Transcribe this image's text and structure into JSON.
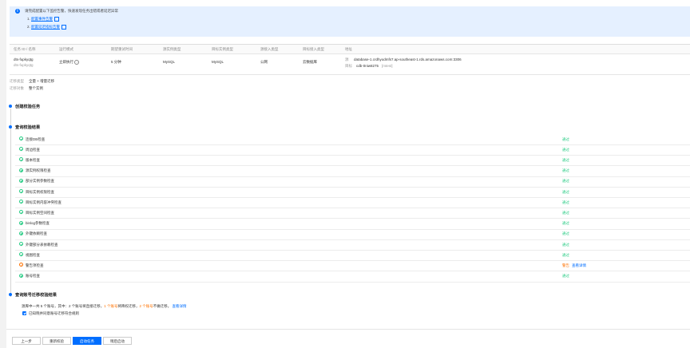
{
  "alert": {
    "message": "请完成配置以下监控告警，快速发现任务出错或者延迟异常",
    "items": [
      {
        "num": "1.",
        "label": "配置事件告警"
      },
      {
        "num": "2.",
        "label": "配置延迟指标告警"
      }
    ]
  },
  "task_table": {
    "columns": [
      "任务 ID / 名称",
      "运行模式",
      "期望重试时间",
      "源实例类型",
      "目标实例类型",
      "源接入类型",
      "目标接入类型",
      "地址"
    ],
    "row": {
      "task_id": "dts-fupkyqtg",
      "task_name": "dts-fupkyqtg",
      "mode": "立即执行",
      "retry": "5 分钟",
      "src_type": "MySQL",
      "dst_type": "MySQL",
      "src_access": "公网",
      "dst_access": "云数据库",
      "src_addr_label": "源",
      "src_addr": "database-1.crdhyodmfs7.ap-southeast-1.rds.amazonaws.com:3306",
      "dst_addr_label": "目标",
      "dst_addr": "cdb-0niw8275",
      "dst_tag": "[mtest]"
    }
  },
  "migration": {
    "type_label": "迁移类型",
    "type_value": "全量 + 增量迁移",
    "object_label": "迁移对象",
    "object_value": "整个实例"
  },
  "sections": {
    "create": "创建校验任务",
    "results": "查询校验结果",
    "account": "查询账号迁移校验结果"
  },
  "checks": [
    {
      "name": "连接DB检查",
      "status": "通过",
      "state": "ok"
    },
    {
      "name": "周边检查",
      "status": "通过",
      "state": "ok"
    },
    {
      "name": "版本检查",
      "status": "通过",
      "state": "ok"
    },
    {
      "name": "源实例权限检查",
      "status": "通过",
      "state": "ok"
    },
    {
      "name": "部分实例参数检查",
      "status": "通过",
      "state": "ok"
    },
    {
      "name": "目标实例权限检查",
      "status": "通过",
      "state": "ok"
    },
    {
      "name": "目标实例内容冲突检查",
      "status": "通过",
      "state": "ok"
    },
    {
      "name": "目标实例空间检查",
      "status": "通过",
      "state": "ok"
    },
    {
      "name": "binlog参数检查",
      "status": "通过",
      "state": "ok"
    },
    {
      "name": "外键依赖检查",
      "status": "通过",
      "state": "ok"
    },
    {
      "name": "外键部分表依赖检查",
      "status": "通过",
      "state": "ok"
    },
    {
      "name": "视图检查",
      "status": "通过",
      "state": "ok"
    },
    {
      "name": "警告项检查",
      "status": "警告",
      "state": "warn",
      "link": "查看详情"
    },
    {
      "name": "账号检查",
      "status": "通过",
      "state": "ok"
    }
  ],
  "account_result": {
    "prefix": "源库中一共 5 个账号，其中：2 个账号将直接迁移，",
    "orange1": "1 个账号",
    "mid": "将降权迁移，",
    "orange2": "2 个账号",
    "suffix": "不做迁移。",
    "link": "查看详情",
    "checkbox_label": "已知晓并同意账号迁移符合规则"
  },
  "footer": {
    "prev": "上一步",
    "recheck": "重新校验",
    "start": "启动任务",
    "save": "稍后启动"
  },
  "colors": {
    "primary": "#006eff",
    "success": "#29cc85",
    "warning": "#ff7200"
  }
}
